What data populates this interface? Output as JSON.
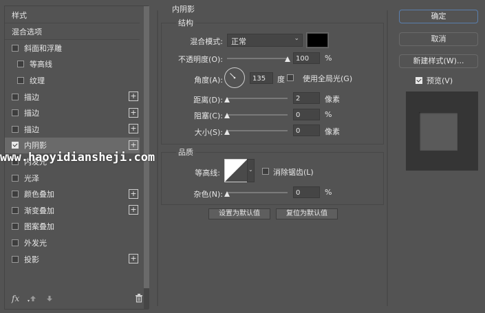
{
  "left_panel": {
    "items": [
      {
        "label": "样式",
        "checkbox": false,
        "checked": false,
        "plus": false,
        "indent": 0
      },
      {
        "label": "混合选项",
        "checkbox": false,
        "checked": false,
        "plus": false,
        "indent": 0
      },
      {
        "label": "斜面和浮雕",
        "checkbox": true,
        "checked": false,
        "plus": false,
        "indent": 0
      },
      {
        "label": "等高线",
        "checkbox": true,
        "checked": false,
        "plus": false,
        "indent": 1
      },
      {
        "label": "纹理",
        "checkbox": true,
        "checked": false,
        "plus": false,
        "indent": 1
      },
      {
        "label": "描边",
        "checkbox": true,
        "checked": false,
        "plus": true,
        "indent": 0
      },
      {
        "label": "描边",
        "checkbox": true,
        "checked": false,
        "plus": true,
        "indent": 0
      },
      {
        "label": "描边",
        "checkbox": true,
        "checked": false,
        "plus": true,
        "indent": 0
      },
      {
        "label": "内阴影",
        "checkbox": true,
        "checked": true,
        "plus": true,
        "indent": 0,
        "selected": true
      },
      {
        "label": "内发光",
        "checkbox": true,
        "checked": false,
        "plus": false,
        "indent": 0
      },
      {
        "label": "光泽",
        "checkbox": true,
        "checked": false,
        "plus": false,
        "indent": 0
      },
      {
        "label": "颜色叠加",
        "checkbox": true,
        "checked": false,
        "plus": true,
        "indent": 0
      },
      {
        "label": "渐变叠加",
        "checkbox": true,
        "checked": false,
        "plus": true,
        "indent": 0
      },
      {
        "label": "图案叠加",
        "checkbox": true,
        "checked": false,
        "plus": false,
        "indent": 0
      },
      {
        "label": "外发光",
        "checkbox": true,
        "checked": false,
        "plus": false,
        "indent": 0
      },
      {
        "label": "投影",
        "checkbox": true,
        "checked": false,
        "plus": true,
        "indent": 0
      }
    ],
    "footer": {
      "fx": "fx",
      "up_icon": "arrow-up-icon",
      "down_icon": "arrow-down-icon",
      "trash_icon": "trash-icon"
    }
  },
  "inner_shadow": {
    "title": "内阴影",
    "structure": {
      "legend": "结构",
      "blend_mode_label": "混合模式:",
      "blend_mode_value": "正常",
      "shadow_color": "#000000",
      "opacity_label": "不透明度(O):",
      "opacity_value": "100",
      "opacity_unit": "%",
      "opacity_fraction": 1.0,
      "angle_label": "角度(A):",
      "angle_value": "135",
      "angle_unit": "度",
      "global_light_label": "使用全局光(G)",
      "distance_label": "距离(D):",
      "distance_value": "2",
      "distance_unit": "像素",
      "distance_fraction": 0.0,
      "choke_label": "阻塞(C):",
      "choke_value": "0",
      "choke_unit": "%",
      "choke_fraction": 0.0,
      "size_label": "大小(S):",
      "size_value": "0",
      "size_unit": "像素",
      "size_fraction": 0.0
    },
    "quality": {
      "legend": "品质",
      "contour_label": "等高线:",
      "antialias_label": "消除锯齿(L)",
      "noise_label": "杂色(N):",
      "noise_value": "0",
      "noise_unit": "%",
      "noise_fraction": 0.0
    },
    "make_default_label": "设置为默认值",
    "reset_default_label": "复位为默认值"
  },
  "right_panel": {
    "ok_label": "确定",
    "cancel_label": "取消",
    "new_style_label": "新建样式(W)...",
    "preview_label": "预览(V)",
    "preview_checked": true
  },
  "watermark": "www.haoyidiansheji.com"
}
